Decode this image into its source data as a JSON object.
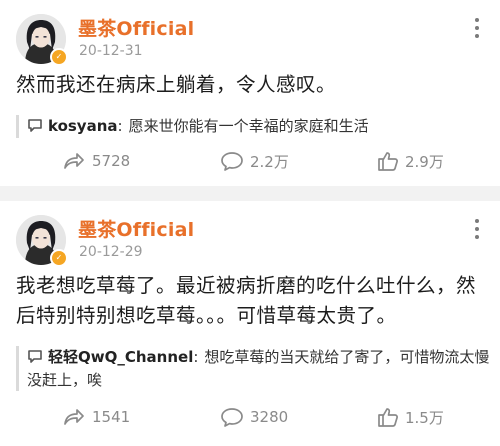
{
  "posts": [
    {
      "author": "墨茶Official",
      "date": "20-12-31",
      "content": "然而我还在病床上躺着，令人感叹。",
      "reply": {
        "user": "kosyana",
        "separator": ":",
        "text": "愿来世你能有一个幸福的家庭和生活"
      },
      "stats": {
        "reposts": "5728",
        "comments": "2.2万",
        "likes": "2.9万"
      }
    },
    {
      "author": "墨茶Official",
      "date": "20-12-29",
      "content": "我老想吃草莓了。最近被病折磨的吃什么吐什么，然后特别特别想吃草莓。。。可惜草莓太贵了。",
      "reply": {
        "user": "轻轻QwQ_Channel",
        "separator": ":",
        "text": "想吃草莓的当天就给了寄了，可惜物流太慢没赶上，唉"
      },
      "stats": {
        "reposts": "1541",
        "comments": "3280",
        "likes": "1.5万"
      }
    }
  ],
  "icons": {
    "more": "more-vertical-icon",
    "reply": "reply-bubble-icon",
    "repost": "repost-arrow-icon",
    "comment": "comment-bubble-icon",
    "like": "thumbs-up-icon",
    "badge": "verified-badge-icon"
  },
  "colors": {
    "author": "#e8702a",
    "badge": "#f5a623",
    "muted": "#8a8a8a",
    "divider": "#f2f2f2"
  }
}
